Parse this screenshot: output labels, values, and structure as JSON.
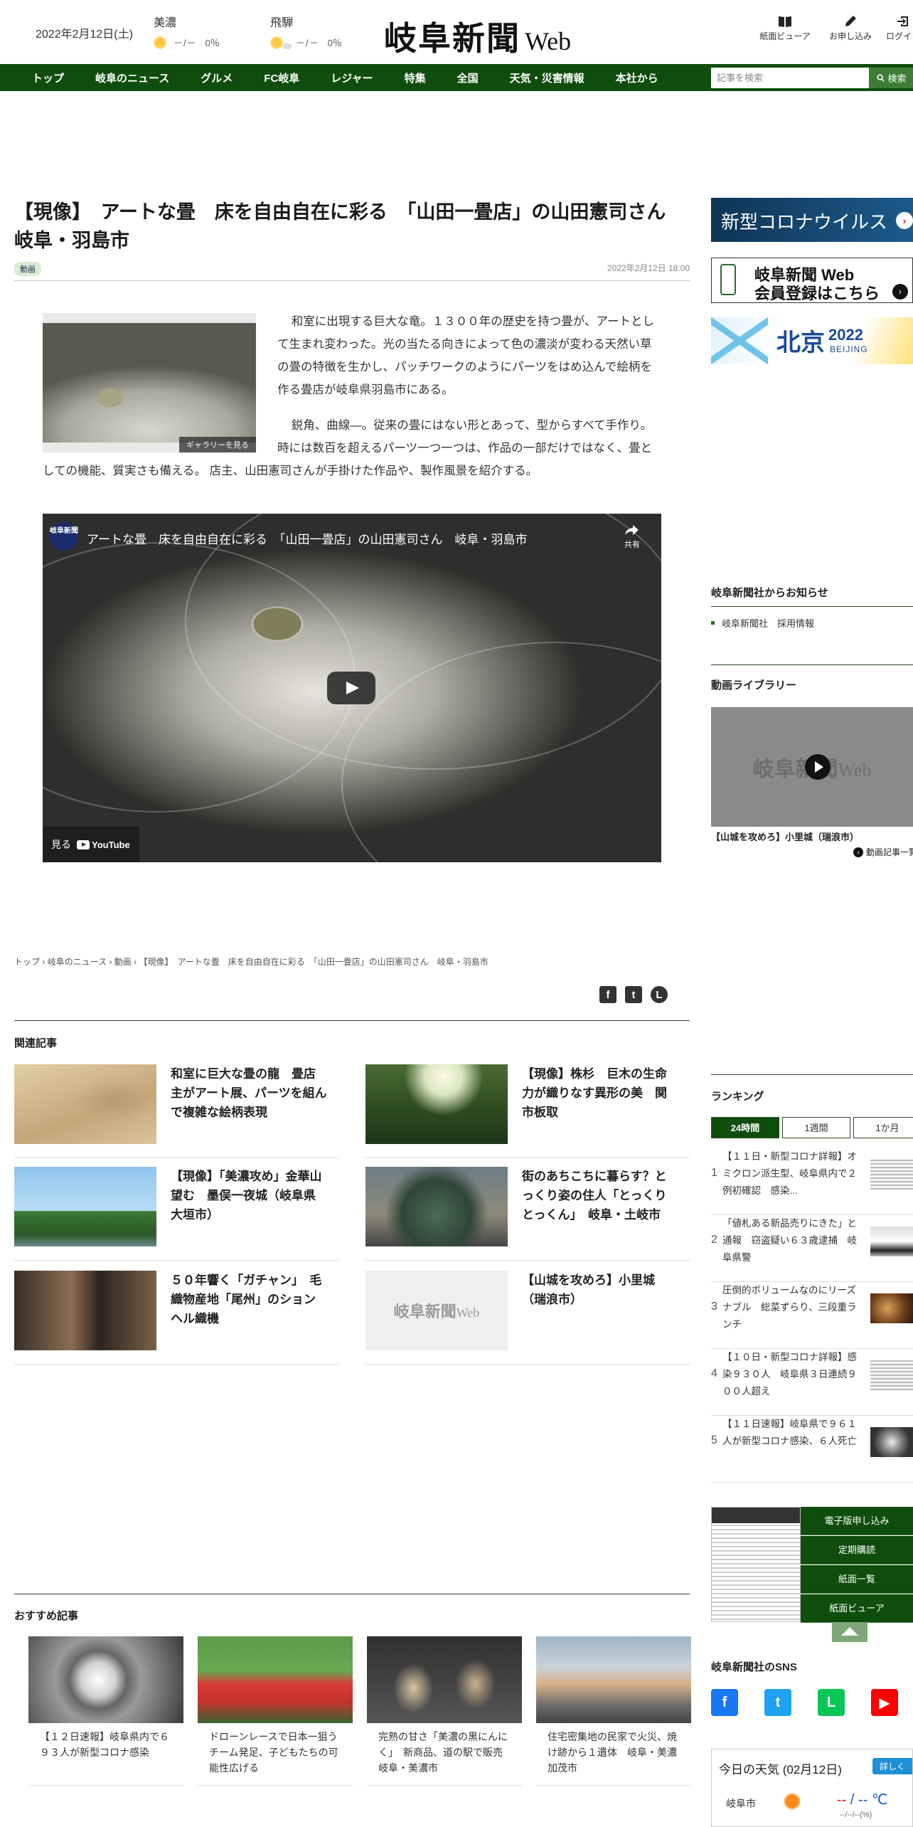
{
  "header": {
    "date": "2022年2月12日(土)",
    "weather": [
      {
        "area": "美濃",
        "temp": "－/－",
        "rain": "0％"
      },
      {
        "area": "飛騨",
        "temp": "－/－",
        "rain": "0％"
      }
    ],
    "logo_kanji": "岐阜新聞",
    "logo_web": "Web",
    "tools": [
      {
        "icon": "book-icon",
        "label": "紙面ビューア"
      },
      {
        "icon": "pen-icon",
        "label": "お申し込み"
      },
      {
        "icon": "login-icon",
        "label": "ログイン"
      }
    ]
  },
  "nav": {
    "items": [
      "トップ",
      "岐阜のニュース",
      "グルメ",
      "FC岐阜",
      "レジャー",
      "特集",
      "全国",
      "天気・災害情報",
      "本社から"
    ],
    "search_placeholder": "記事を検索",
    "search_button": "検索"
  },
  "article": {
    "title": "【現像】　アートな畳　床を自由自在に彩る　「山田一畳店」の山田憲司さん　岐阜・羽島市",
    "tag": "動画",
    "date": "2022年2月12日 18:00",
    "gallery_caption": "ギャラリーを見る",
    "paragraphs": [
      "和室に出現する巨大な竜。１３００年の歴史を持つ畳が、アートとして生まれ変わった。光の当たる向きによって色の濃淡が変わる天然い草の畳の特徴を生かし、パッチワークのようにパーツをはめ込んで絵柄を作る畳店が岐阜県羽島市にある。",
      "鋭角、曲線―。従来の畳にはない形とあって、型からすべて手作り。時には数百を超えるパーツ一つ一つは、作品の一部だけではなく、畳としての機能、質実さも備える。 店主、山田憲司さんが手掛けた作品や、製作風景を紹介する。"
    ],
    "video": {
      "channel_badge": "岐阜新聞",
      "title": "アートな畳　床を自由自在に彩る　「山田一畳店」の山田憲司さん　岐阜・羽島市",
      "share": "共有",
      "watch": "見る",
      "brand": "YouTube"
    }
  },
  "breadcrumb": [
    "トップ",
    "岐阜のニュース",
    "動画",
    "【現像】　アートな畳　床を自由自在に彩る　「山田一畳店」の山田憲司さん　岐阜・羽島市"
  ],
  "breadcrumb_sep": "›",
  "share_icons": [
    "f",
    "t",
    "L"
  ],
  "related": {
    "heading": "関連記事",
    "items": [
      {
        "title": "和室に巨大な畳の龍　畳店主がアート展、パーツを組んで複雑な絵柄表現",
        "img": "tatami"
      },
      {
        "title": "【現像】株杉　巨木の生命力が織りなす異形の美　関市板取",
        "img": "forest"
      },
      {
        "title": "【現像】「美濃攻め」金華山望む　墨俣一夜城（岐阜県大垣市）",
        "img": "castle"
      },
      {
        "title": "街のあちこちに暮らす？とっくり姿の住人「とっくりとっくん」　岐阜・土岐市",
        "img": "tokkuri"
      },
      {
        "title": "５０年響く「ガチャン」　毛織物産地「尾州」のションヘル織機",
        "img": "loom"
      },
      {
        "title": "【山城を攻めろ】小里城（瑞浪市）",
        "img": "placeholder"
      }
    ],
    "placeholder_logo": "岐阜新聞",
    "placeholder_web": "Web"
  },
  "recommended": {
    "heading": "おすすめ記事",
    "items": [
      {
        "title": "【１２日速報】岐阜県内で６９３人が新型コロナ感染",
        "img": "virus"
      },
      {
        "title": "ドローンレースで日本一狙う　チーム発足、子どもたちの可能性広げる",
        "img": "drone"
      },
      {
        "title": "完熟の甘さ「美濃の黒にんにく」　新商品、道の駅で販売　岐阜・美濃市",
        "img": "negi"
      },
      {
        "title": "住宅密集地の民家で火災、焼け跡から１遺体　岐阜・美濃加茂市",
        "img": "fire"
      }
    ]
  },
  "sidebar": {
    "corona_banner": "新型コロナウイルス",
    "member_banner_line1": "岐阜新聞 Web",
    "member_banner_line2": "会員登録はこちら",
    "beijing_banner": {
      "city": "北京",
      "year": "2022",
      "en": "BEIJING"
    },
    "notice_heading": "岐阜新聞社からお知らせ",
    "notice_item": "岐阜新聞社　採用情報",
    "video_library_heading": "動画ライブラリー",
    "video_library_title": "【山城を攻めろ】小里城（瑞浪市）",
    "video_library_more": "動画記事一覧",
    "ranking_heading": "ランキング",
    "ranking_tabs": [
      "24時間",
      "1週間",
      "1か月"
    ],
    "ranking_items": [
      {
        "rank": "1",
        "title": "【１１日・新型コロナ詳報】オミクロン派生型、岐阜県内で２例初確認　感染..."
      },
      {
        "rank": "2",
        "title": "「値札ある新品売りにきた」と通報　窃盗疑い６３歳逮捕　岐阜県警"
      },
      {
        "rank": "3",
        "title": "圧倒的ボリュームなのにリーズナブル　総菜ずらり、三段重ランチ"
      },
      {
        "rank": "4",
        "title": "【１０日・新型コロナ詳報】感染９３０人　岐阜県３日連続９００人超え"
      },
      {
        "rank": "5",
        "title": "【１１日速報】岐阜県で９６１人が新型コロナ感染、６人死亡"
      }
    ],
    "paper_buttons": [
      "電子版申し込み",
      "定期購読",
      "紙面一覧",
      "紙面ビューア"
    ],
    "sns_heading": "岐阜新聞社のSNS",
    "sns": [
      {
        "label": "f",
        "color": "#1877f2"
      },
      {
        "label": "t",
        "color": "#1da1f2"
      },
      {
        "label": "L",
        "color": "#06c755"
      },
      {
        "label": "▶",
        "color": "#ff0000"
      }
    ],
    "weather_box": {
      "title": "今日の天気 (02月12日)",
      "detail": "詳しく",
      "city": "岐阜市",
      "temp_hi": "--",
      "sep": " / ",
      "temp_lo": "--",
      "unit": " ℃",
      "pct": "--/--/--(%)"
    }
  }
}
